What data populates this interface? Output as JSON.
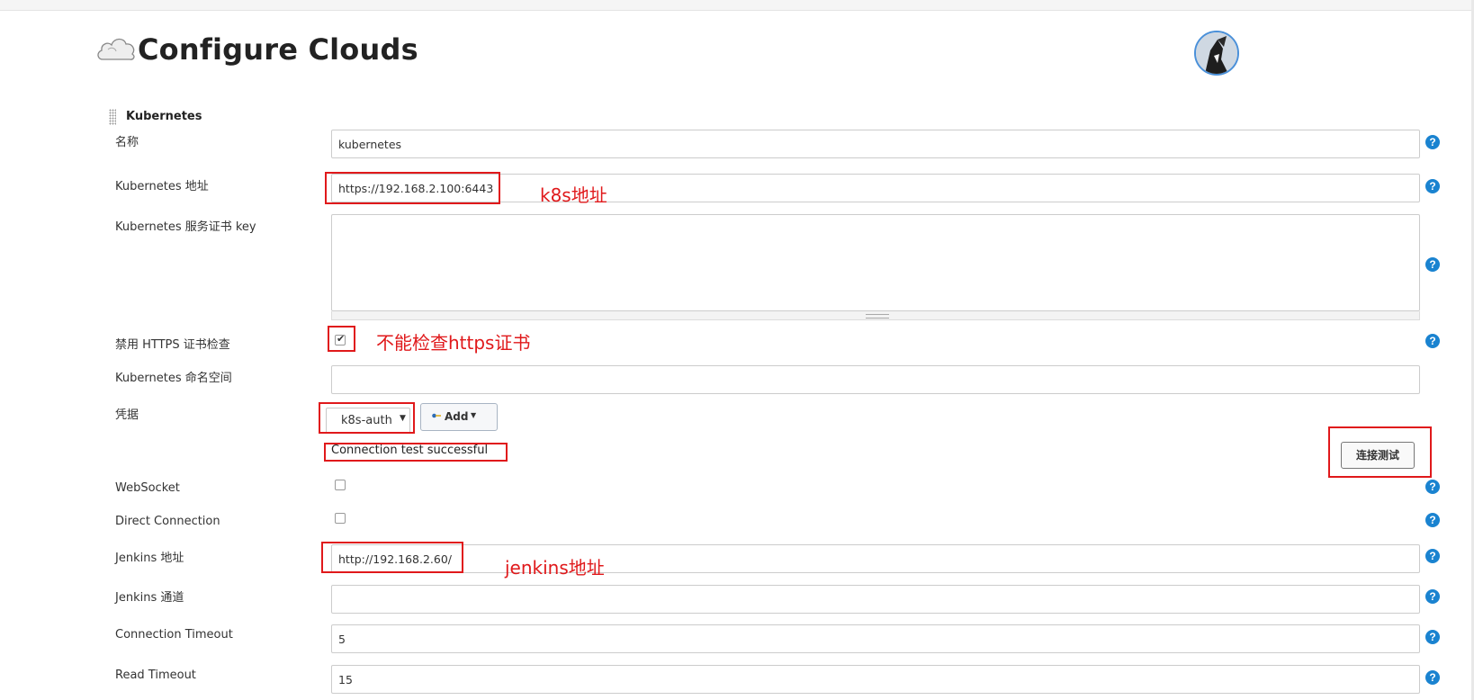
{
  "header": {
    "title": "Configure Clouds"
  },
  "section": {
    "title": "Kubernetes"
  },
  "fields": {
    "name": {
      "label": "名称",
      "value": "kubernetes"
    },
    "url": {
      "label": "Kubernetes 地址",
      "value": "https://192.168.2.100:6443"
    },
    "cert_key": {
      "label": "Kubernetes 服务证书 key",
      "value": ""
    },
    "skip_tls": {
      "label": "禁用 HTTPS 证书检查",
      "checked": true
    },
    "namespace": {
      "label": "Kubernetes 命名空间",
      "value": ""
    },
    "credentials": {
      "label": "凭据",
      "selected": "k8s-auth",
      "add_label": "Add"
    },
    "connection_status": "Connection test successful",
    "test_button": "连接测试",
    "websocket": {
      "label": "WebSocket",
      "checked": false
    },
    "direct_connection": {
      "label": "Direct Connection",
      "checked": false
    },
    "jenkins_url": {
      "label": "Jenkins 地址",
      "value": "http://192.168.2.60/"
    },
    "jenkins_tunnel": {
      "label": "Jenkins 通道",
      "value": ""
    },
    "connection_timeout": {
      "label": "Connection Timeout",
      "value": "5"
    },
    "read_timeout": {
      "label": "Read Timeout",
      "value": "15"
    }
  },
  "help_symbol": "?",
  "annotations": {
    "k8s_url": "k8s地址",
    "https_check": "不能检查https证书",
    "jenkins_url": "jenkins地址"
  },
  "colors": {
    "annotation": "#e0191b",
    "help": "#1a83d0"
  }
}
